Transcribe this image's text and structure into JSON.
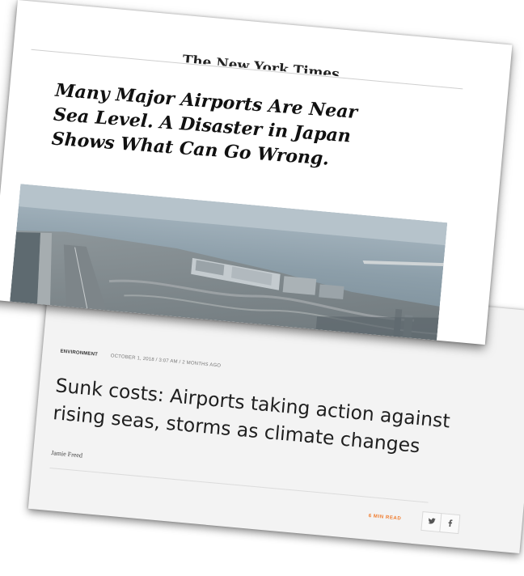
{
  "front_article": {
    "masthead": "The New York Times",
    "headline": "Many Major Airports Are Near Sea Level. A Disaster in Japan Shows What Can Go Wrong."
  },
  "back_article": {
    "category": "ENVIRONMENT",
    "date": "OCTOBER 1, 2018 / 3:07 AM / 2 MONTHS AGO",
    "headline": "Sunk costs: Airports taking action against rising seas, storms as climate changes",
    "byline": "Jamie Freed",
    "read_time": "6 MIN READ",
    "share": {
      "twitter_icon": "twitter-icon",
      "facebook_icon": "facebook-icon"
    }
  },
  "colors": {
    "read_time_accent": "#f07a2b",
    "card_back_bg": "#f3f3f3",
    "card_front_bg": "#ffffff"
  }
}
